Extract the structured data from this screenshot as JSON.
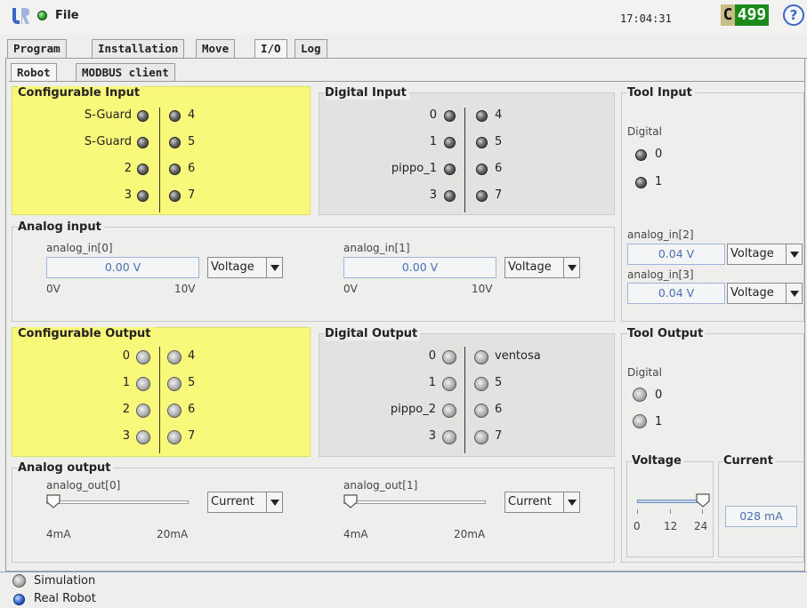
{
  "header": {
    "file_label": "File",
    "clock": "17:04:31",
    "counter_letter": "C",
    "counter_number": "499",
    "help_symbol": "?"
  },
  "tabs": [
    "Program",
    "Installation",
    "Move",
    "I/O",
    "Log"
  ],
  "active_tab": "I/O",
  "subtabs": [
    "Robot",
    "MODBUS client"
  ],
  "active_subtab": "Robot",
  "configurable_input": {
    "title": "Configurable Input",
    "left": [
      "S-Guard",
      "S-Guard",
      "2",
      "3"
    ],
    "right": [
      "4",
      "5",
      "6",
      "7"
    ]
  },
  "digital_input": {
    "title": "Digital Input",
    "left": [
      "0",
      "1",
      "pippo_1",
      "3"
    ],
    "right": [
      "4",
      "5",
      "6",
      "7"
    ]
  },
  "tool_input": {
    "title": "Tool Input",
    "digital_label": "Digital",
    "digital": [
      "0",
      "1"
    ],
    "analog": [
      {
        "name": "analog_in[2]",
        "value": "0.04 V",
        "mode": "Voltage"
      },
      {
        "name": "analog_in[3]",
        "value": "0.04 V",
        "mode": "Voltage"
      }
    ]
  },
  "analog_input": {
    "title": "Analog input",
    "channels": [
      {
        "name": "analog_in[0]",
        "value": "0.00 V",
        "mode": "Voltage",
        "min": "0V",
        "max": "10V"
      },
      {
        "name": "analog_in[1]",
        "value": "0.00 V",
        "mode": "Voltage",
        "min": "0V",
        "max": "10V"
      }
    ]
  },
  "configurable_output": {
    "title": "Configurable Output",
    "left": [
      "0",
      "1",
      "2",
      "3"
    ],
    "right": [
      "4",
      "5",
      "6",
      "7"
    ]
  },
  "digital_output": {
    "title": "Digital Output",
    "left": [
      "0",
      "1",
      "pippo_2",
      "3"
    ],
    "right": [
      "ventosa",
      "5",
      "6",
      "7"
    ]
  },
  "tool_output": {
    "title": "Tool Output",
    "digital_label": "Digital",
    "digital": [
      "0",
      "1"
    ],
    "voltage_title": "Voltage",
    "voltage_ticks": [
      "0",
      "12",
      "24"
    ],
    "voltage_level_fraction": 1.0,
    "current_title": "Current",
    "current_value": "028 mA"
  },
  "analog_output": {
    "title": "Analog output",
    "channels": [
      {
        "name": "analog_out[0]",
        "mode": "Current",
        "min": "4mA",
        "max": "20mA",
        "level_fraction": 0.0
      },
      {
        "name": "analog_out[1]",
        "mode": "Current",
        "min": "4mA",
        "max": "20mA",
        "level_fraction": 0.0
      }
    ]
  },
  "footer": {
    "simulation_label": "Simulation",
    "real_robot_label": "Real Robot"
  },
  "colors": {
    "configurable_bg": "#f8f87a",
    "digital_bg": "#e2e2e0",
    "counter_green": "#1a8a1a",
    "counter_tan": "#c9be86",
    "accent_blue": "#3a66c4"
  }
}
